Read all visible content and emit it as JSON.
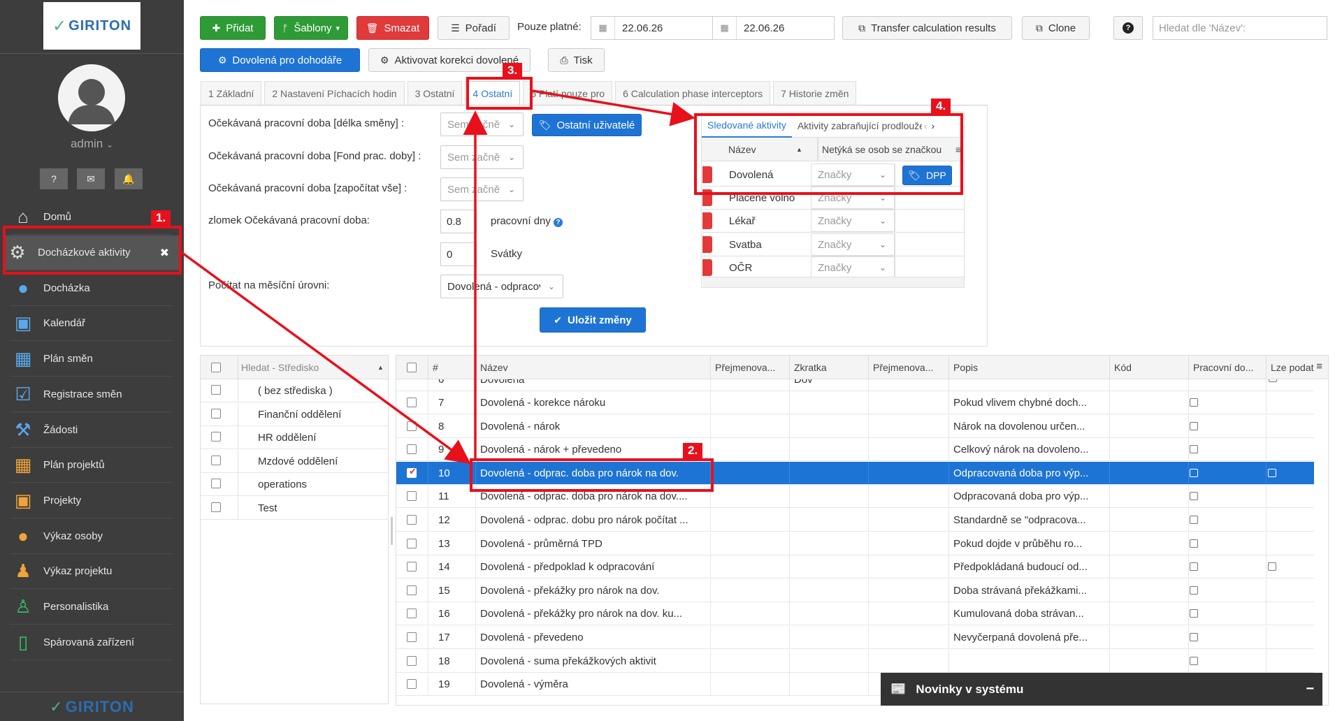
{
  "sidebar": {
    "logo": "GIRITON",
    "user": "admin",
    "items": [
      {
        "label": "Domů",
        "icon": "home-icon"
      },
      {
        "label": "Docházkové aktivity",
        "icon": "gears-icon"
      },
      {
        "label": "Docházka",
        "icon": "person-icon"
      },
      {
        "label": "Kalendář",
        "icon": "calendar-icon"
      },
      {
        "label": "Plán směn",
        "icon": "calendar-grid-icon"
      },
      {
        "label": "Registrace směn",
        "icon": "calendar-check-icon"
      },
      {
        "label": "Žádosti",
        "icon": "gavel-icon"
      },
      {
        "label": "Plán projektů",
        "icon": "calendar-grid-icon"
      },
      {
        "label": "Projekty",
        "icon": "calendar-icon"
      },
      {
        "label": "Výkaz osoby",
        "icon": "person-icon"
      },
      {
        "label": "Výkaz projektu",
        "icon": "group-icon"
      },
      {
        "label": "Personalistika",
        "icon": "standing-person-icon"
      },
      {
        "label": "Spárovaná zařízení",
        "icon": "phone-icon"
      }
    ],
    "bottom_logo": "GIRITON"
  },
  "toolbar": {
    "add": "Přidat",
    "templates": "Šablony",
    "delete": "Smazat",
    "order": "Pořadí",
    "valid_only": "Pouze platné:",
    "date_from": "22.06.26",
    "date_to": "22.06.26",
    "transfer": "Transfer calculation results",
    "clone": "Clone",
    "search_placeholder": "Hledat dle 'Název':",
    "agreement_vacation": "Dovolená pro dohodáře",
    "activate_correction": "Aktivovat korekci dovolené",
    "print": "Tisk"
  },
  "tabs": [
    "1 Základní",
    "2 Nastavení Píchacích hodin",
    "3 Ostatní",
    "4 Ostatní",
    "5 Platí pouze pro",
    "6 Calculation phase interceptors",
    "7 Historie změn"
  ],
  "form": {
    "expected_shift": "Očekávaná pracovní doba [délka směny] :",
    "expected_fund": "Očekávaná pracovní doba [Fond prac. doby] :",
    "expected_all": "Očekávaná pracovní doba [započítat vše] :",
    "fraction": "zlomek Očekávaná pracovní doba:",
    "select_placeholder": "Sem začněte psát",
    "other_users": "Ostatní uživatelé",
    "fraction_value": "0.8",
    "workdays": "pracovní dny",
    "holidays_value": "0",
    "holidays": "Svátky",
    "monthly": "Počítat na měsíční úrovni:",
    "monthly_value": "Dovolená - odpracovaná",
    "save": "Uložit změny"
  },
  "subpanel": {
    "tab_tracked": "Sledované aktivity",
    "tab_blocking": "Aktivity zabraňující prodloužení",
    "col_name": "Název",
    "col_not_apply": "Netýká se osob se značkou",
    "tags_placeholder": "Značky",
    "rows": [
      "Dovolená",
      "Placené volno",
      "Lékař",
      "Svatba",
      "OČR"
    ],
    "dpp_tag": "DPP"
  },
  "centers": {
    "header": "Hledat - Středisko",
    "items": [
      "( bez střediska )",
      "Finanční oddělení",
      "HR oddělení",
      "Mzdové oddělení",
      "operations",
      "Test"
    ]
  },
  "grid": {
    "headers": [
      "#",
      "Název",
      "Přejmenova...",
      "Zkratka",
      "Přejmenova...",
      "Popis",
      "Kód",
      "Pracovní do...",
      "Lze podat"
    ],
    "partial_row": {
      "num": "6",
      "name": "Dovolená",
      "abbr": "Dov"
    },
    "rows": [
      {
        "num": "7",
        "name": "Dovolená - korekce nároku",
        "desc": "Pokud vlivem chybné doch..."
      },
      {
        "num": "8",
        "name": "Dovolená - nárok",
        "desc": "Nárok na dovolenou určen..."
      },
      {
        "num": "9",
        "name": "Dovolená - nárok + převedeno",
        "desc": "Celkový nárok na dovoleno..."
      },
      {
        "num": "10",
        "name": "Dovolená - odprac. doba pro nárok na dov.",
        "desc": "Odpracovaná doba pro výp..."
      },
      {
        "num": "11",
        "name": "Dovolená - odprac. doba pro nárok na dov....",
        "desc": "Odpracovaná doba pro výp..."
      },
      {
        "num": "12",
        "name": "Dovolená - odprac. dobu pro nárok počítat ...",
        "desc": "Standardně se \"odpracova..."
      },
      {
        "num": "13",
        "name": "Dovolená - průměrná TPD",
        "desc": "Pokud dojde v průběhu ro..."
      },
      {
        "num": "14",
        "name": "Dovolená - předpoklad k odpracování",
        "desc": "Předpokládaná budoucí od..."
      },
      {
        "num": "15",
        "name": "Dovolená - překážky pro nárok na dov.",
        "desc": "Doba strávaná překážkami..."
      },
      {
        "num": "16",
        "name": "Dovolená - překážky pro nárok na dov. ku...",
        "desc": "Kumulovaná doba strávan..."
      },
      {
        "num": "17",
        "name": "Dovolená - převedeno",
        "desc": "Nevyčerpaná dovolená pře..."
      },
      {
        "num": "18",
        "name": "Dovolená - suma překážkových aktivit",
        "desc": ""
      },
      {
        "num": "19",
        "name": "Dovolená - výměra",
        "desc": ""
      }
    ]
  },
  "annotations": [
    "1.",
    "2.",
    "3.",
    "4."
  ],
  "news": "Novinky v systému",
  "colors": {
    "annotation": "#e8101b",
    "selected_row": "#1e74d4",
    "sidebar": "#3d3d3d"
  }
}
